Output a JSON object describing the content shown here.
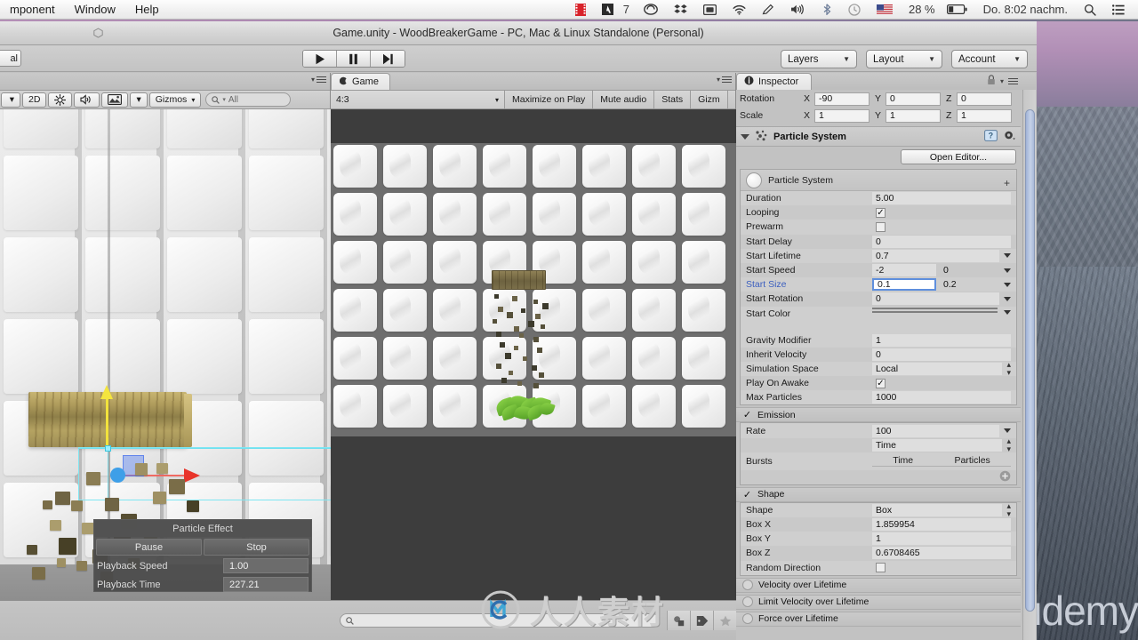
{
  "menubar": {
    "items": [
      "mponent",
      "Window",
      "Help"
    ],
    "status_icons": [
      {
        "name": "film-strip-icon",
        "glyph": "film"
      },
      {
        "name": "adobe-icon",
        "glyph": "A"
      },
      {
        "name": "adobe-count",
        "glyph": "7"
      },
      {
        "name": "creative-cloud-icon",
        "glyph": "cc"
      },
      {
        "name": "dropbox-icon",
        "glyph": "db"
      },
      {
        "name": "display-icon",
        "glyph": "disp"
      },
      {
        "name": "wifi-icon",
        "glyph": "wifi"
      },
      {
        "name": "pencil-icon",
        "glyph": "pencil"
      },
      {
        "name": "volume-icon",
        "glyph": "vol"
      },
      {
        "name": "bluetooth-icon",
        "glyph": "bt"
      },
      {
        "name": "time-machine-icon",
        "glyph": "tm"
      },
      {
        "name": "flag-icon",
        "glyph": "flag"
      }
    ],
    "battery_percent": "28 %",
    "clock": "Do. 8:02 nachm.",
    "search_icon": "search-icon",
    "notification_icon": "notification-center-icon"
  },
  "unity": {
    "title": "Game.unity - WoodBreakerGame - PC, Mac & Linux Standalone (Personal)",
    "toolbar": {
      "left_cap": "al",
      "play": "▶",
      "pause": "❚❚",
      "step": "▶❚",
      "layers": "Layers",
      "layout": "Layout",
      "account": "Account"
    }
  },
  "scene": {
    "tab": "",
    "toolbar": {
      "mode_caret": "▾",
      "twod": "2D",
      "light_icon": "lighting-icon",
      "audio_icon": "audio-icon",
      "fx_icon": "effects-icon",
      "fx_caret": "▾",
      "gizmos": "Gizmos",
      "search_placeholder": "All"
    },
    "particle_effect": {
      "title": "Particle Effect",
      "pause": "Pause",
      "stop": "Stop",
      "playback_speed_label": "Playback Speed",
      "playback_speed_value": "1.00",
      "playback_time_label": "Playback Time",
      "playback_time_value": "227.21"
    }
  },
  "game": {
    "tab": "Game",
    "toolbar": {
      "aspect": "4:3",
      "maximize_on_play": "Maximize on Play",
      "mute_audio": "Mute audio",
      "stats": "Stats",
      "gizmos": "Gizm"
    },
    "project_search_placeholder": ""
  },
  "inspector": {
    "tab": "Inspector",
    "transform": {
      "rotation_label": "Rotation",
      "rotation": {
        "x": "-90",
        "y": "0",
        "z": "0"
      },
      "scale_label": "Scale",
      "scale": {
        "x": "1",
        "y": "1",
        "z": "1"
      },
      "axis_x": "X",
      "axis_y": "Y",
      "axis_z": "Z"
    },
    "component": {
      "title": "Particle System",
      "open_editor": "Open Editor...",
      "module_title": "Particle System"
    },
    "main_module": [
      {
        "label": "Duration",
        "value": "5.00",
        "type": "text"
      },
      {
        "label": "Looping",
        "value": "✓",
        "type": "checkbox_on"
      },
      {
        "label": "Prewarm",
        "value": "",
        "type": "checkbox_off"
      },
      {
        "label": "Start Delay",
        "value": "0",
        "type": "text"
      },
      {
        "label": "Start Lifetime",
        "value": "0.7",
        "type": "text_caret"
      },
      {
        "label": "Start Speed",
        "value": "-2",
        "value2": "0",
        "type": "dual_caret"
      },
      {
        "label": "Start Size",
        "value": "0.1",
        "value2": "0.2",
        "type": "dual_caret_focus",
        "highlight": true
      },
      {
        "label": "Start Rotation",
        "value": "0",
        "type": "text_caret"
      },
      {
        "label": "Start Color",
        "value": "",
        "type": "color_gradient"
      },
      {
        "label": "Gravity Modifier",
        "value": "1",
        "type": "text"
      },
      {
        "label": "Inherit Velocity",
        "value": "0",
        "type": "text"
      },
      {
        "label": "Simulation Space",
        "value": "Local",
        "type": "dropdown"
      },
      {
        "label": "Play On Awake",
        "value": "✓",
        "type": "checkbox_on"
      },
      {
        "label": "Max Particles",
        "value": "1000",
        "type": "text"
      }
    ],
    "start_color": {
      "top": "#4d4731",
      "bottom": "#b6a873"
    },
    "emission": {
      "header": "Emission",
      "enabled": true,
      "rate_label": "Rate",
      "rate_value": "100",
      "rate_mode": "Time",
      "bursts_label": "Bursts",
      "bursts_col_time": "Time",
      "bursts_col_particles": "Particles"
    },
    "shape": {
      "header": "Shape",
      "enabled": true,
      "rows": [
        {
          "label": "Shape",
          "value": "Box",
          "type": "dropdown"
        },
        {
          "label": "Box X",
          "value": "1.859954",
          "type": "text"
        },
        {
          "label": "Box Y",
          "value": "1",
          "type": "text"
        },
        {
          "label": "Box Z",
          "value": "0.6708465",
          "type": "text"
        },
        {
          "label": "Random Direction",
          "value": "",
          "type": "checkbox_off"
        }
      ]
    },
    "collapsed_modules": [
      "Velocity over Lifetime",
      "Limit Velocity over Lifetime",
      "Force over Lifetime"
    ]
  },
  "watermarks": {
    "cn_logo": "人人素材",
    "udemy": "udemy"
  },
  "colors": {
    "unity_bg": "#c2c2c2",
    "focus_blue": "#5f8fdd",
    "label_blue": "#3c5fbf",
    "gizmo_yellow": "#f2e23c",
    "gizmo_red": "#e8342a",
    "gizmo_blue": "#3e9fe8",
    "select_cyan": "#6fe0ef"
  }
}
